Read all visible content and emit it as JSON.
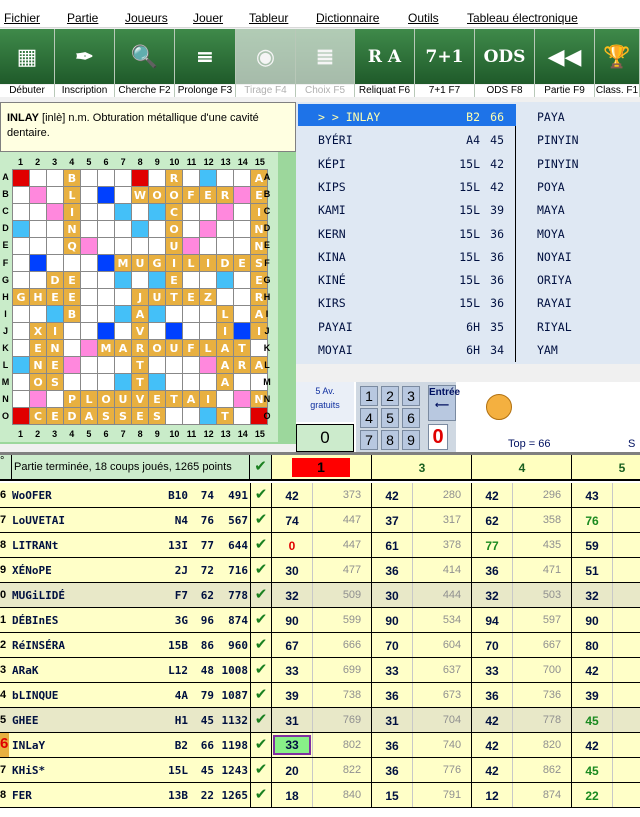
{
  "menu": [
    "Fichier",
    "Partie",
    "Joueurs",
    "Jouer",
    "Tableur",
    "Dictionnaire",
    "Outils",
    "Tableau électronique"
  ],
  "toolbar": [
    {
      "label": "Débuter",
      "icon": "scrabble-board-icon",
      "glyph": "▦",
      "enabled": true
    },
    {
      "label": "Inscription",
      "icon": "quill-pen-icon",
      "glyph": "✒",
      "enabled": true
    },
    {
      "label": "Cherche F2",
      "icon": "magnifier-icon",
      "glyph": "🔍",
      "enabled": true
    },
    {
      "label": "Prolonge F3",
      "icon": "abacus-icon",
      "glyph": "≡",
      "enabled": true
    },
    {
      "label": "Tirage F4",
      "icon": "tile-bag-icon",
      "glyph": "◉",
      "enabled": false
    },
    {
      "label": "Choix F5",
      "icon": "choice-list-icon",
      "glyph": "≣",
      "enabled": false
    },
    {
      "label": "Reliquat F6",
      "icon": "remaining-tiles-icon",
      "glyph": "R A",
      "enabled": true
    },
    {
      "label": "7+1 F7",
      "icon": "seven-plus-one-icon",
      "glyph": "7+1",
      "enabled": true
    },
    {
      "label": "ODS F8",
      "icon": "dictionary-book-icon",
      "glyph": "ODS",
      "enabled": true
    },
    {
      "label": "Partie F9",
      "icon": "rewind-icon",
      "glyph": "◀◀",
      "enabled": true
    },
    {
      "label": "Class. F1",
      "icon": "trophy-icon",
      "glyph": "🏆",
      "enabled": true
    }
  ],
  "definition": {
    "word": "INLAY",
    "rest": " [inlè] n.m. Obturation métallique d'une cavité dentaire."
  },
  "board": {
    "columns": [
      "1",
      "2",
      "3",
      "4",
      "5",
      "6",
      "7",
      "8",
      "9",
      "10",
      "11",
      "12",
      "13",
      "14",
      "15"
    ],
    "rows": [
      "A",
      "B",
      "C",
      "D",
      "E",
      "F",
      "G",
      "H",
      "I",
      "J",
      "K",
      "L",
      "M",
      "N",
      "O"
    ],
    "grid": [
      "...B.....R....A",
      "...L...WOOFER.E",
      "...I.....C....I",
      "...N.....O....N",
      "...Q.....U....N",
      "......MUGILIDES",
      "..DE.....E....E",
      "GHEE...JUTEZ..R",
      "...B...A....L.A",
      ".XI....V....I.I",
      ".EN..MAROUFLAT.",
      ".NE....T....ARAK",
      ".OS....T....A..",
      "...PLOUVETAI..N",
      ".CEDASSES...T.."
    ]
  },
  "words": {
    "left": [
      {
        "word": "> > INLAY",
        "pos": "B2",
        "score": "66",
        "selected": true
      },
      {
        "word": "BYÉRI",
        "pos": "A4",
        "score": "45"
      },
      {
        "word": "KÉPI",
        "pos": "15L",
        "score": "42"
      },
      {
        "word": "KIPS",
        "pos": "15L",
        "score": "42"
      },
      {
        "word": "KAMI",
        "pos": "15L",
        "score": "39"
      },
      {
        "word": "KERN",
        "pos": "15L",
        "score": "36"
      },
      {
        "word": "KINA",
        "pos": "15L",
        "score": "36"
      },
      {
        "word": "KINÉ",
        "pos": "15L",
        "score": "36"
      },
      {
        "word": "KIRS",
        "pos": "15L",
        "score": "36"
      },
      {
        "word": "PAYAI",
        "pos": "6H",
        "score": "35"
      },
      {
        "word": "MOYAI",
        "pos": "6H",
        "score": "34"
      }
    ],
    "right": [
      "PAYA",
      "PINYIN",
      "PINYIN",
      "POYA",
      "MAYA",
      "MOYA",
      "NOYAI",
      "ORIYA",
      "RAYAI",
      "RIYAL",
      "YAM"
    ]
  },
  "control": {
    "avg_line1": "5 Av.",
    "avg_line2": "gratuits",
    "counter": "0",
    "keys": [
      "1",
      "2",
      "3",
      "4",
      "5",
      "6",
      "7",
      "8",
      "9"
    ],
    "enter": "Entrée",
    "zero": "0",
    "top": "Top = 66",
    "truncated": "S"
  },
  "table": {
    "status": "Partie terminée, 18 coups joués, 1265 points",
    "rank_header": "°",
    "players": [
      "1",
      "3",
      "4",
      "5"
    ],
    "rows": [
      {
        "n": "6",
        "word": "WoOFER",
        "pos": "B10",
        "score": "74",
        "total": "491",
        "p": [
          [
            "42",
            "373"
          ],
          [
            "42",
            "280"
          ],
          [
            "42",
            "296"
          ],
          [
            "43",
            ""
          ]
        ]
      },
      {
        "n": "7",
        "word": "LoUVETAI",
        "pos": "N4",
        "score": "76",
        "total": "567",
        "p": [
          [
            "74",
            "447"
          ],
          [
            "37",
            "317"
          ],
          [
            "62",
            "358"
          ],
          [
            "76",
            ""
          ]
        ]
      },
      {
        "n": "8",
        "word": "LITRANt",
        "pos": "13I",
        "score": "77",
        "total": "644",
        "p": [
          [
            "0",
            "447"
          ],
          [
            "61",
            "378"
          ],
          [
            "77",
            "435"
          ],
          [
            "59",
            ""
          ]
        ]
      },
      {
        "n": "9",
        "word": "XÉNoPE",
        "pos": "2J",
        "score": "72",
        "total": "716",
        "p": [
          [
            "30",
            "477"
          ],
          [
            "36",
            "414"
          ],
          [
            "36",
            "471"
          ],
          [
            "51",
            ""
          ]
        ]
      },
      {
        "n": "0",
        "word": "MUGiLIDÉ",
        "pos": "F7",
        "score": "62",
        "total": "778",
        "p": [
          [
            "32",
            "509"
          ],
          [
            "30",
            "444"
          ],
          [
            "32",
            "503"
          ],
          [
            "32",
            ""
          ]
        ]
      },
      {
        "n": "1",
        "word": "DÉBInES",
        "pos": "3G",
        "score": "96",
        "total": "874",
        "p": [
          [
            "90",
            "599"
          ],
          [
            "90",
            "534"
          ],
          [
            "94",
            "597"
          ],
          [
            "90",
            ""
          ]
        ]
      },
      {
        "n": "2",
        "word": "RéINSÉRA",
        "pos": "15B",
        "score": "86",
        "total": "960",
        "p": [
          [
            "67",
            "666"
          ],
          [
            "70",
            "604"
          ],
          [
            "70",
            "667"
          ],
          [
            "80",
            ""
          ]
        ]
      },
      {
        "n": "3",
        "word": "ARaK",
        "pos": "L12",
        "score": "48",
        "total": "1008",
        "p": [
          [
            "33",
            "699"
          ],
          [
            "33",
            "637"
          ],
          [
            "33",
            "700"
          ],
          [
            "42",
            ""
          ]
        ]
      },
      {
        "n": "4",
        "word": "bLINQUE",
        "pos": "4A",
        "score": "79",
        "total": "1087",
        "p": [
          [
            "39",
            "738"
          ],
          [
            "36",
            "673"
          ],
          [
            "36",
            "736"
          ],
          [
            "39",
            ""
          ]
        ]
      },
      {
        "n": "5",
        "word": "GHEE",
        "pos": "H1",
        "score": "45",
        "total": "1132",
        "p": [
          [
            "31",
            "769"
          ],
          [
            "31",
            "704"
          ],
          [
            "42",
            "778"
          ],
          [
            "45",
            ""
          ]
        ]
      },
      {
        "n": "6",
        "word": "INLaY",
        "pos": "B2",
        "score": "66",
        "total": "1198",
        "p": [
          [
            "33",
            "802"
          ],
          [
            "36",
            "740"
          ],
          [
            "42",
            "820"
          ],
          [
            "42",
            ""
          ]
        ]
      },
      {
        "n": "7",
        "word": "KHiS*",
        "pos": "15L",
        "score": "45",
        "total": "1243",
        "p": [
          [
            "20",
            "822"
          ],
          [
            "36",
            "776"
          ],
          [
            "42",
            "862"
          ],
          [
            "45",
            ""
          ]
        ]
      },
      {
        "n": "8",
        "word": "FER",
        "pos": "13B",
        "score": "22",
        "total": "1265",
        "p": [
          [
            "18",
            "840"
          ],
          [
            "15",
            "791"
          ],
          [
            "12",
            "874"
          ],
          [
            "22",
            ""
          ]
        ]
      }
    ]
  },
  "colors": {
    "accent": "#1e73e8",
    "tile": "#e8b040",
    "tw": "#e00000",
    "dw": "#ff88dd",
    "tl": "#0040ff",
    "dl": "#44c0f8",
    "ok": "#1a8020"
  }
}
